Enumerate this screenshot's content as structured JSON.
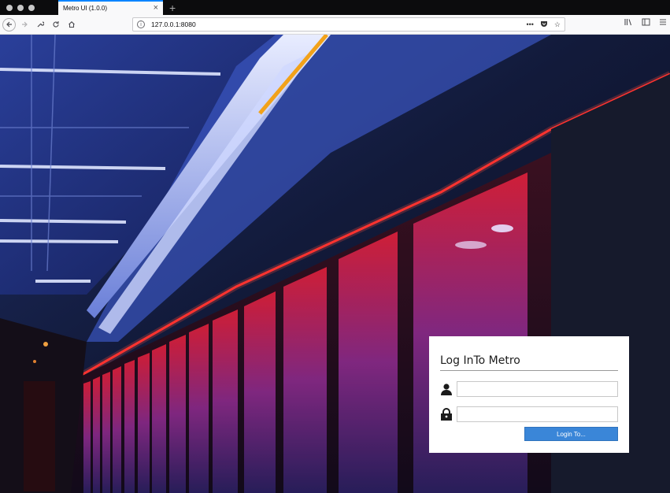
{
  "browser": {
    "tab_title": "Metro UI (1.0.0)",
    "tab_close": "×",
    "new_tab": "+",
    "url": "127.0.0.1:8080",
    "back_icon": "back-arrow-icon",
    "forward_icon": "forward-arrow-icon",
    "tools_icon": "wrench-icon",
    "reload_icon": "reload-icon",
    "home_icon": "home-icon",
    "menu_icons": [
      "library-icon",
      "sidebar-icon",
      "hamburger-menu-icon"
    ]
  },
  "login": {
    "title": "Log InTo Metro",
    "username_value": "",
    "password_value": "",
    "button_label": "Login To..."
  },
  "colors": {
    "accent": "#3a86d8",
    "tab_highlight": "#0a84ff",
    "card_background": "#ffffff"
  }
}
